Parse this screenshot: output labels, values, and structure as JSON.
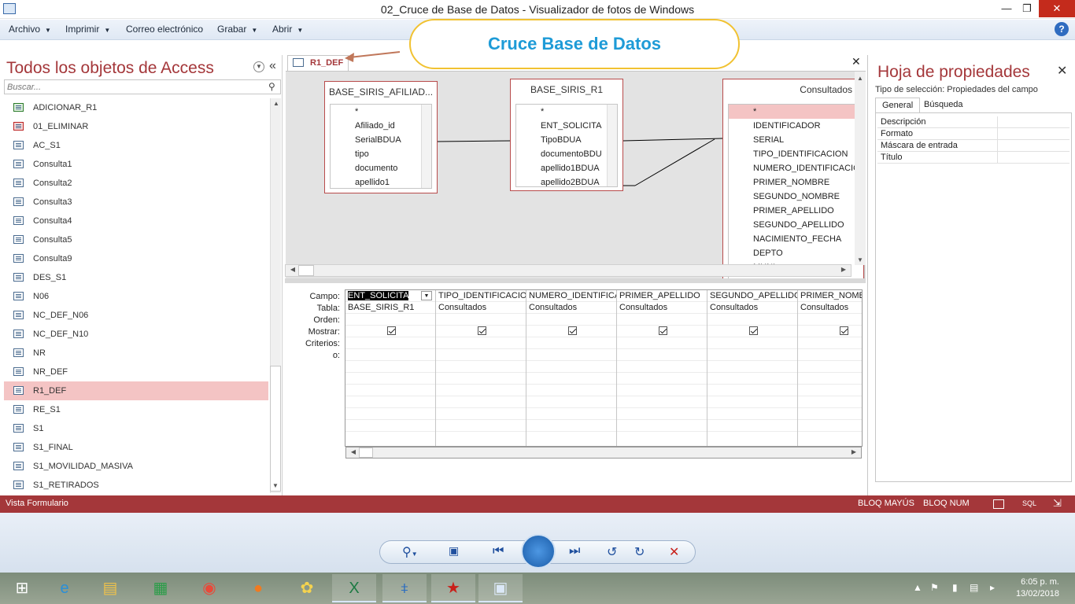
{
  "window": {
    "title": "02_Cruce de Base de Datos - Visualizador de fotos de Windows",
    "minimize": "—",
    "restore": "❐",
    "close": "✕"
  },
  "menu": {
    "items": [
      "Archivo",
      "Imprimir",
      "Correo electrónico",
      "Grabar",
      "Abrir"
    ],
    "help": "?"
  },
  "callout": {
    "text": "Cruce Base de Datos"
  },
  "nav": {
    "title": "Todos los objetos de Access",
    "search_placeholder": "Buscar...",
    "items": [
      {
        "label": "ADICIONAR_R1",
        "icon": "append-query-icon"
      },
      {
        "label": "01_ELIMINAR",
        "icon": "delete-query-icon"
      },
      {
        "label": "AC_S1",
        "icon": "query-icon"
      },
      {
        "label": "Consulta1",
        "icon": "query-icon"
      },
      {
        "label": "Consulta2",
        "icon": "query-icon"
      },
      {
        "label": "Consulta3",
        "icon": "query-icon"
      },
      {
        "label": "Consulta4",
        "icon": "query-icon"
      },
      {
        "label": "Consulta5",
        "icon": "query-icon"
      },
      {
        "label": "Consulta9",
        "icon": "query-icon"
      },
      {
        "label": "DES_S1",
        "icon": "query-icon"
      },
      {
        "label": "N06",
        "icon": "query-icon"
      },
      {
        "label": "NC_DEF_N06",
        "icon": "query-icon"
      },
      {
        "label": "NC_DEF_N10",
        "icon": "query-icon"
      },
      {
        "label": "NR",
        "icon": "query-icon"
      },
      {
        "label": "NR_DEF",
        "icon": "query-icon"
      },
      {
        "label": "R1_DEF",
        "icon": "query-icon",
        "selected": true
      },
      {
        "label": "RE_S1",
        "icon": "query-icon"
      },
      {
        "label": "S1",
        "icon": "query-icon"
      },
      {
        "label": "S1_FINAL",
        "icon": "query-icon"
      },
      {
        "label": "S1_MOVILIDAD_MASIVA",
        "icon": "query-icon"
      },
      {
        "label": "S1_RETIRADOS",
        "icon": "query-icon"
      }
    ]
  },
  "query": {
    "tab_label": "R1_DEF",
    "close": "✕",
    "tables": [
      {
        "name": "BASE_SIRIS_AFILIAD...",
        "fields": [
          "*",
          "Afiliado_id",
          "SerialBDUA",
          "tipo",
          "documento",
          "apellido1"
        ]
      },
      {
        "name": "BASE_SIRIS_R1",
        "fields": [
          "*",
          "ENT_SOLICITA",
          "TipoBDUA",
          "documentoBDU",
          "apellido1BDUA",
          "apellido2BDUA"
        ]
      },
      {
        "name": "Consultados",
        "fields": [
          "*",
          "IDENTIFICADOR",
          "SERIAL",
          "TIPO_IDENTIFICACION",
          "NUMERO_IDENTIFICACIO",
          "PRIMER_NOMBRE",
          "SEGUNDO_NOMBRE",
          "PRIMER_APELLIDO",
          "SEGUNDO_APELLIDO",
          "NACIMIENTO_FECHA",
          "DEPTO",
          "MUNI"
        ]
      }
    ],
    "grid": {
      "row_labels": [
        "Campo:",
        "Tabla:",
        "Orden:",
        "Mostrar:",
        "Criterios:",
        "o:"
      ],
      "columns": [
        {
          "campo": "ENT_SOLICITA",
          "tabla": "BASE_SIRIS_R1",
          "mostrar": true
        },
        {
          "campo": "TIPO_IDENTIFICACION",
          "tabla": "Consultados",
          "mostrar": true
        },
        {
          "campo": "NUMERO_IDENTIFICA",
          "tabla": "Consultados",
          "mostrar": true
        },
        {
          "campo": "PRIMER_APELLIDO",
          "tabla": "Consultados",
          "mostrar": true
        },
        {
          "campo": "SEGUNDO_APELLIDO",
          "tabla": "Consultados",
          "mostrar": true
        },
        {
          "campo": "PRIMER_NOMB",
          "tabla": "Consultados",
          "mostrar": true
        }
      ]
    }
  },
  "props": {
    "title": "Hoja de propiedades",
    "close": "✕",
    "selection_type": "Tipo de selección:  Propiedades del campo",
    "tabs": [
      "General",
      "Búsqueda"
    ],
    "rows": [
      "Descripción",
      "Formato",
      "Máscara de entrada",
      "Título"
    ]
  },
  "status": {
    "left": "Vista Formulario",
    "caps": "BLOQ MAYÚS",
    "num": "BLOQ NUM",
    "sql": "SQL"
  },
  "taskbar": {
    "time": "6:05 p. m.",
    "date": "13/02/2018"
  },
  "colors": {
    "access_red": "#a4373a",
    "callout_text": "#1e9bd7",
    "callout_border": "#f1c232",
    "selected_item": "#f4c4c4"
  }
}
